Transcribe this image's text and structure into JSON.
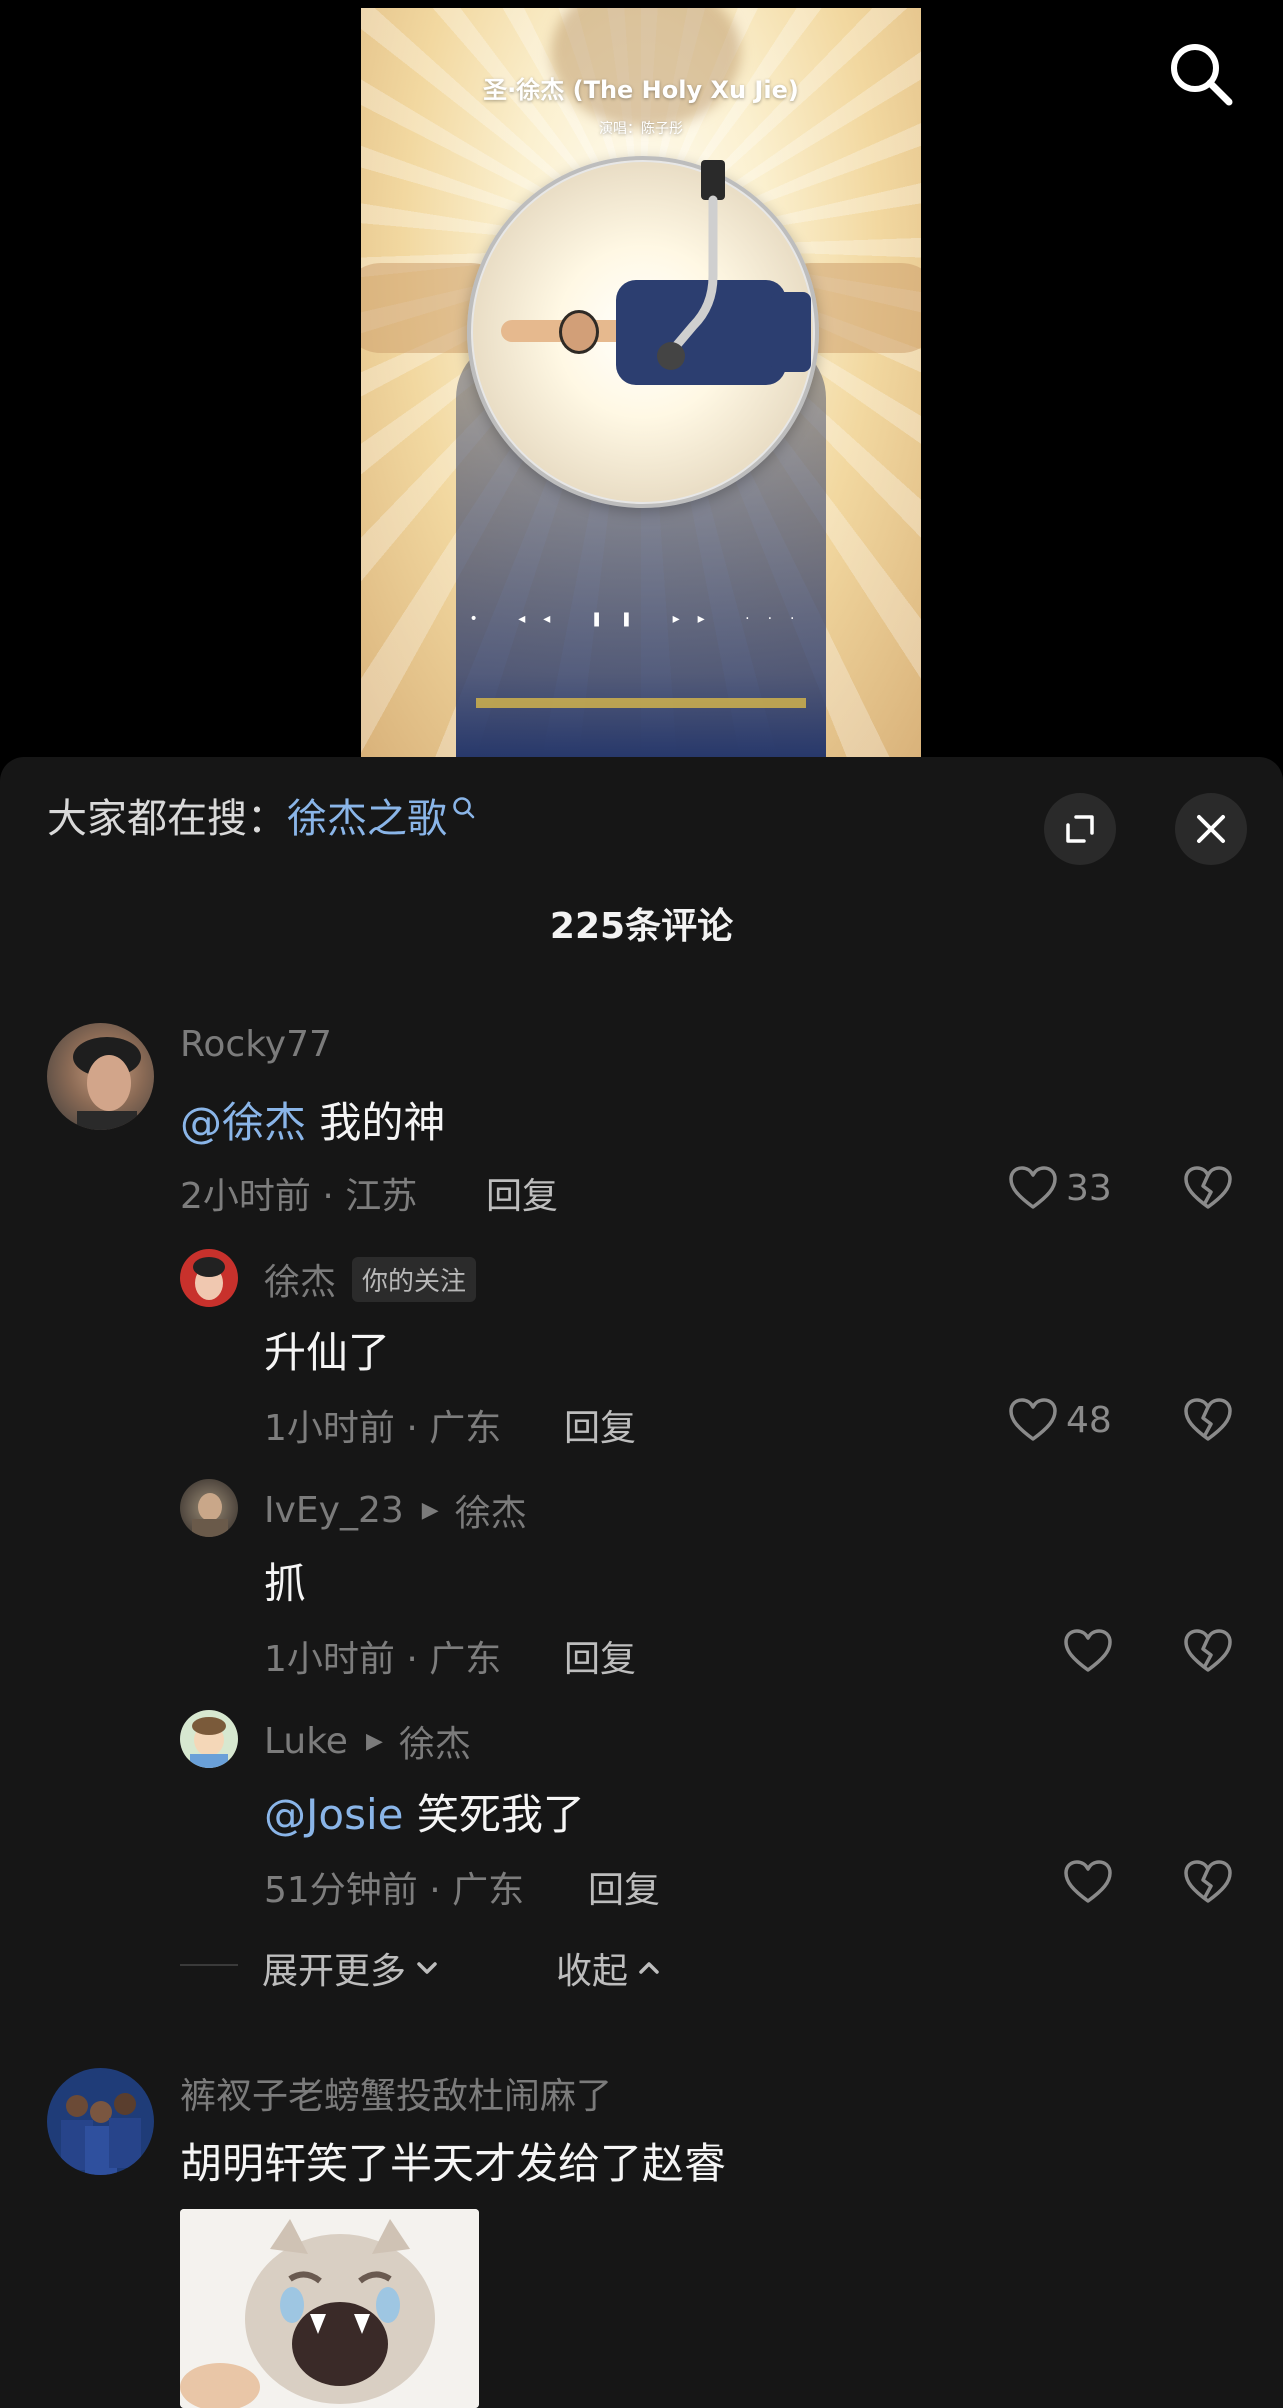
{
  "video": {
    "title": "圣·徐杰 (The Holy Xu Jie)",
    "subtitle": "演唱：陈子彤",
    "controls": "•  ◂◂  ❚❚  ▸▸  ···"
  },
  "top_bar": {
    "search_icon": "search-icon"
  },
  "comments_panel": {
    "trending_label": "大家都在搜：",
    "trending_keyword": "徐杰之歌",
    "expand_icon": "expand-icon",
    "close_icon": "close-icon",
    "comment_count": "225条评论",
    "comments": [
      {
        "user": "Rocky77",
        "mention": "@徐杰",
        "text": " 我的神",
        "meta": "2小时前 · 江苏",
        "reply_label": "回复",
        "likes": "33"
      },
      {
        "user": "徐杰",
        "badge": "你的关注",
        "text": "升仙了",
        "meta": "1小时前 · 广东",
        "reply_label": "回复",
        "likes": "48"
      },
      {
        "user": "IvEy_23",
        "reply_to": "徐杰",
        "text": "抓",
        "meta": "1小时前 · 广东",
        "reply_label": "回复",
        "likes": ""
      },
      {
        "user": "Luke",
        "reply_to": "徐杰",
        "mention": "@Josie",
        "text": " 笑死我了",
        "meta": "51分钟前 · 广东",
        "reply_label": "回复",
        "likes": ""
      },
      {
        "user": "裤衩子老螃蟹投敌杜闹麻了",
        "text": "胡明轩笑了半天才发给了赵睿"
      }
    ],
    "expand_more_label": "展开更多",
    "collapse_label": "收起"
  }
}
